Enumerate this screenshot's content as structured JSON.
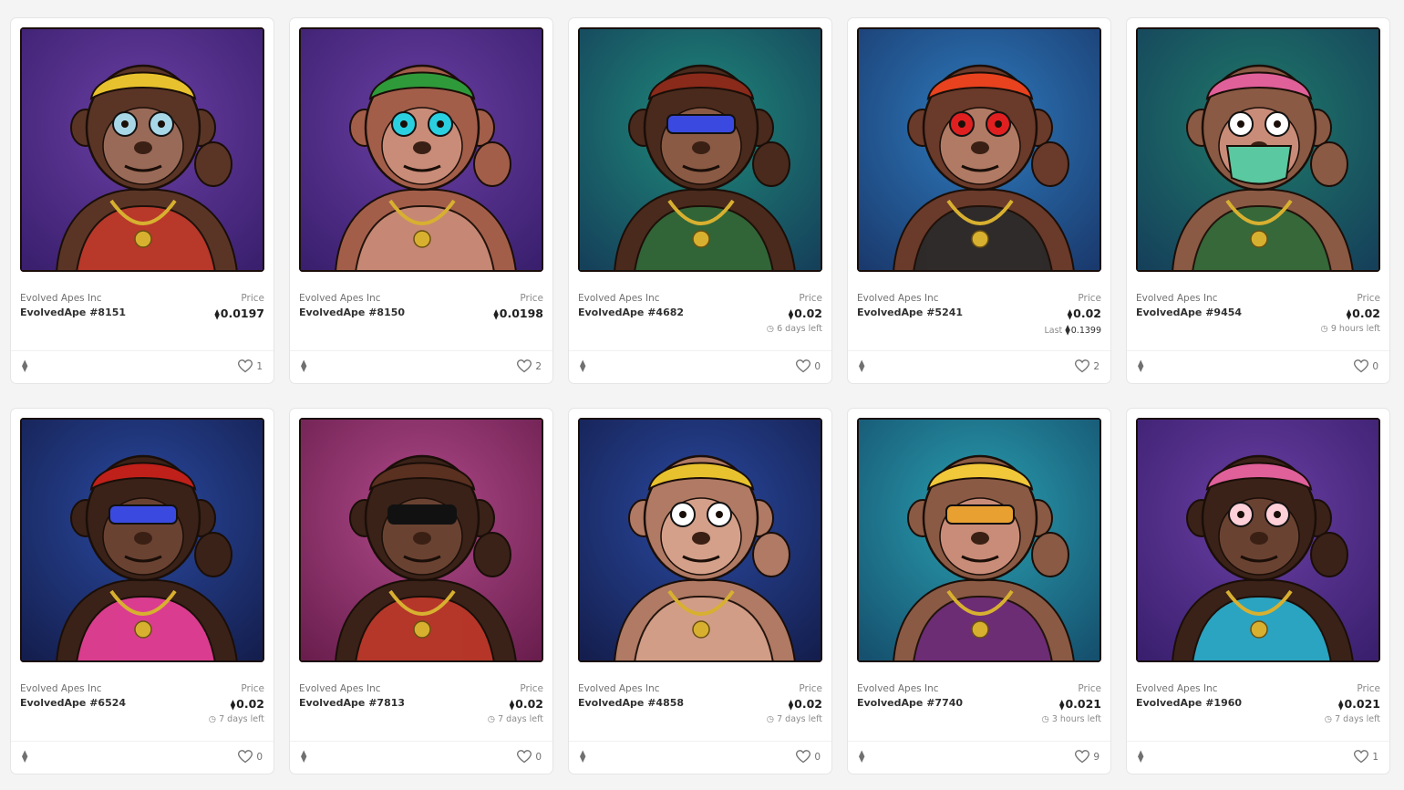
{
  "colors": {
    "page_bg": "#f4f4f4",
    "card_bg": "#ffffff",
    "text_muted": "#707070",
    "text_strong": "#303030"
  },
  "cards": [
    {
      "collection": "Evolved Apes Inc",
      "name": "EvolvedApe #8151",
      "price_label": "Price",
      "price": "0.0197",
      "sub": "",
      "likes": "1",
      "art": {
        "bg1": "#6a3fa3",
        "bg2": "#3a1f6e",
        "fur": "#5a3526",
        "face": "#9a6a58",
        "outfit": "#c0392b",
        "hat": "#e8c22e",
        "eyes": "glasses"
      }
    },
    {
      "collection": "Evolved Apes Inc",
      "name": "EvolvedApe #8150",
      "price_label": "Price",
      "price": "0.0198",
      "sub": "",
      "likes": "2",
      "art": {
        "bg1": "#6a3fa3",
        "bg2": "#3a1f6e",
        "fur": "#a35e4a",
        "face": "#c98c78",
        "outfit": "#c98c78",
        "hat": "#2f9a3a",
        "eyes": "stars"
      }
    },
    {
      "collection": "Evolved Apes Inc",
      "name": "EvolvedApe #4682",
      "price_label": "Price",
      "price": "0.02",
      "sub_icon": "clock-icon",
      "sub": "6 days left",
      "likes": "0",
      "art": {
        "bg1": "#1f8a7a",
        "bg2": "#15405a",
        "fur": "#4a2a1c",
        "face": "#8a5a44",
        "outfit": "#2f6a3a",
        "hat": "#8a2a1a",
        "eyes": "visor"
      }
    },
    {
      "collection": "Evolved Apes Inc",
      "name": "EvolvedApe #5241",
      "price_label": "Price",
      "price": "0.02",
      "sub_prefix": "Last",
      "sub": "0.1399",
      "likes": "2",
      "art": {
        "bg1": "#2e7bbd",
        "bg2": "#1a3a6e",
        "fur": "#6a3a2a",
        "face": "#b07a64",
        "outfit": "#2a2a2a",
        "hat": "#e8421f",
        "eyes": "stars-red"
      }
    },
    {
      "collection": "Evolved Apes Inc",
      "name": "EvolvedApe #9454",
      "price_label": "Price",
      "price": "0.02",
      "sub_icon": "clock-icon",
      "sub": "9 hours left",
      "likes": "0",
      "art": {
        "bg1": "#1f7a6a",
        "bg2": "#15405a",
        "fur": "#8a5a44",
        "face": "#c98c78",
        "outfit": "#2f6a3a",
        "hat": "#e0609a",
        "eyes": "mask"
      }
    },
    {
      "collection": "Evolved Apes Inc",
      "name": "EvolvedApe #6524",
      "price_label": "Price",
      "price": "0.02",
      "sub_icon": "clock-icon",
      "sub": "7 days left",
      "likes": "0",
      "art": {
        "bg1": "#2a4aa0",
        "bg2": "#141e4e",
        "fur": "#3a2218",
        "face": "#6a4232",
        "outfit": "#e8409a",
        "hat": "#c0201a",
        "eyes": "visor"
      }
    },
    {
      "collection": "Evolved Apes Inc",
      "name": "EvolvedApe #7813",
      "price_label": "Price",
      "price": "0.02",
      "sub_icon": "clock-icon",
      "sub": "7 days left",
      "likes": "0",
      "art": {
        "bg1": "#b04a8a",
        "bg2": "#6a1e4e",
        "fur": "#3a2218",
        "face": "#6a4232",
        "outfit": "#c0392b",
        "hat": "#5a3020",
        "eyes": "pixel"
      }
    },
    {
      "collection": "Evolved Apes Inc",
      "name": "EvolvedApe #4858",
      "price_label": "Price",
      "price": "0.02",
      "sub_icon": "clock-icon",
      "sub": "7 days left",
      "likes": "0",
      "art": {
        "bg1": "#2a4aa0",
        "bg2": "#141e4e",
        "fur": "#b07a64",
        "face": "#d4a08a",
        "outfit": "#d4a08a",
        "hat": "#e8c22e",
        "eyes": "sleepy"
      }
    },
    {
      "collection": "Evolved Apes Inc",
      "name": "EvolvedApe #7740",
      "price_label": "Price",
      "price": "0.021",
      "sub_icon": "clock-icon",
      "sub": "3 hours left",
      "likes": "9",
      "art": {
        "bg1": "#2aa0b0",
        "bg2": "#15506e",
        "fur": "#8a5a44",
        "face": "#c98c78",
        "outfit": "#6a2a7a",
        "hat": "#f0c83a",
        "eyes": "shutter"
      }
    },
    {
      "collection": "Evolved Apes Inc",
      "name": "EvolvedApe #1960",
      "price_label": "Price",
      "price": "0.021",
      "sub_icon": "clock-icon",
      "sub": "7 days left",
      "likes": "1",
      "art": {
        "bg1": "#6a3fa3",
        "bg2": "#3a1f6e",
        "fur": "#3a2218",
        "face": "#6a4232",
        "outfit": "#2ab0d0",
        "hat": "#e0609a",
        "eyes": "round"
      }
    }
  ]
}
